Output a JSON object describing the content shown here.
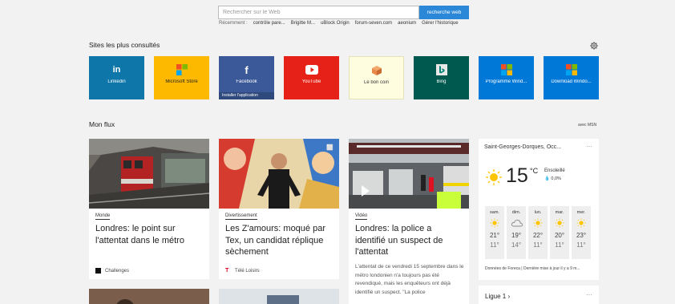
{
  "search": {
    "placeholder": "Rechercher sur le Web",
    "button_label": "recherche web",
    "recent_label": "Récemment :",
    "recent_items": [
      "contrôle pare...",
      "Brigitte M...",
      "uBlock Origin",
      "forum-seven.com",
      "aeonium"
    ],
    "manage_label": "Gérer l'historique"
  },
  "topsites": {
    "title": "Sites les plus consultés",
    "tiles": [
      {
        "label": "Linkedin",
        "color": "#0e76a8",
        "icon": "linkedin-icon"
      },
      {
        "label": "Microsoft Store",
        "color": "#fdb900",
        "icon": "windows-icon"
      },
      {
        "label": "Facebook",
        "sub": "Installer l'application",
        "color": "#3b5998",
        "icon": "facebook-icon"
      },
      {
        "label": "YouTube",
        "color": "#e62117",
        "icon": "youtube-icon"
      },
      {
        "label": "Le bon coin",
        "color": "#fffde0",
        "icon": "box-icon"
      },
      {
        "label": "Bing",
        "color": "#008373",
        "icon": "bing-icon"
      },
      {
        "label": "Programme Wind...",
        "color": "#0078d7",
        "icon": "windows-icon"
      },
      {
        "label": "Download Windo...",
        "color": "#0078d7",
        "icon": "windows-icon"
      }
    ]
  },
  "feed": {
    "title": "Mon flux",
    "msn": "avec MSN",
    "cards": [
      {
        "category": "Monde",
        "title": "Londres: le point sur l'attentat dans le métro",
        "source": "Challenges"
      },
      {
        "category": "Divertissement",
        "title": "Les Z'amours: moqué par Tex, un candidat réplique sèchement",
        "source": "Télé Loisirs"
      },
      {
        "category": "Vidéo",
        "title": "Londres: la police a identifié un suspect de l'attentat",
        "excerpt": "L'attentat de ce vendredi 15 septembre dans le métro londonien n'a toujours pas été revendiqué, mais les enquêteurs ont déjà identifié un suspect. \"La police"
      }
    ]
  },
  "weather": {
    "city": "Saint-Georges-Dorques, Occ...",
    "temp": "15",
    "unit": "°C",
    "condition": "Ensoleillé",
    "rain": "0,0%",
    "days": [
      {
        "name": "sam.",
        "hi": "21°",
        "lo": "11°",
        "icon": "sun-icon"
      },
      {
        "name": "dim.",
        "hi": "19°",
        "lo": "14°",
        "icon": "cloud-icon"
      },
      {
        "name": "lun.",
        "hi": "22°",
        "lo": "11°",
        "icon": "sun-icon"
      },
      {
        "name": "mar.",
        "hi": "20°",
        "lo": "11°",
        "icon": "sun-icon"
      },
      {
        "name": "mer.",
        "hi": "23°",
        "lo": "11°",
        "icon": "sun-icon"
      }
    ],
    "footer": "Données de Foreca | Dernière mise à jour il y a 9 m..."
  },
  "ligue": {
    "label": "Ligue 1"
  },
  "more_glyph": "···"
}
